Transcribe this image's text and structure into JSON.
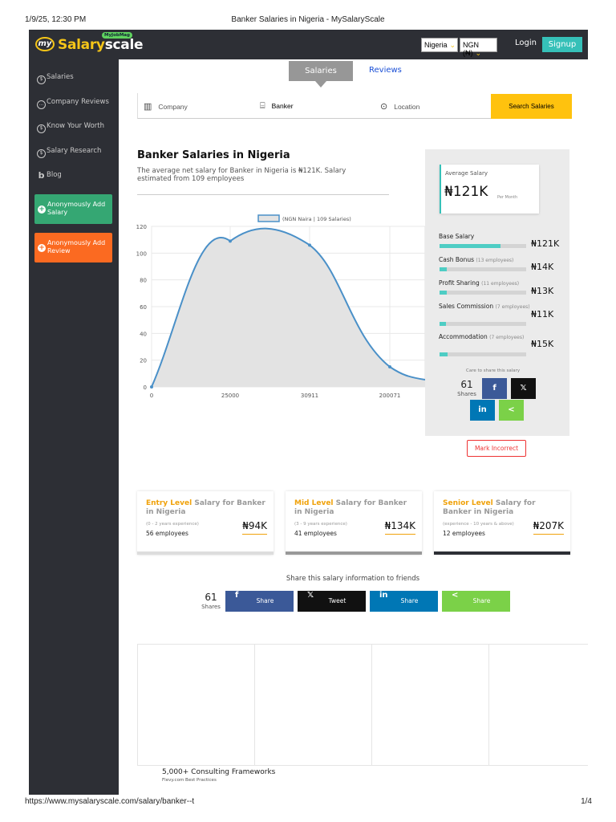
{
  "print": {
    "datetime": "1/9/25, 12:30 PM",
    "title": "Banker Salaries in Nigeria - MySalaryScale",
    "url": "https://www.mysalaryscale.com/salary/banker--t",
    "page": "1/4"
  },
  "header": {
    "logo_my": "my",
    "logo_salary": "Salary",
    "logo_scale": "scale",
    "logo_badge": "MyJobMag",
    "country": "Nigeria",
    "currency": "NGN (₦)",
    "login": "Login",
    "signup": "Signup"
  },
  "sidebar": {
    "items": [
      {
        "label": "Salaries",
        "icon": "salaries-icon",
        "glyph": "$"
      },
      {
        "label": "Company Reviews",
        "icon": "chat-icon",
        "glyph": "…"
      },
      {
        "label": "Know Your Worth",
        "icon": "money-icon",
        "glyph": "$"
      },
      {
        "label": "Salary Research",
        "icon": "search-icon",
        "glyph": "$"
      },
      {
        "label": "Blog",
        "icon": "blog-icon",
        "glyph": "b"
      }
    ],
    "add_salary": "Anonymously Add Salary",
    "add_review": "Anonymously Add Review"
  },
  "tabs": {
    "salaries": "Salaries",
    "reviews": "Reviews"
  },
  "search": {
    "company": "Company",
    "job": "Banker",
    "location": "Location",
    "button": "Search Salaries"
  },
  "main": {
    "heading": "Banker Salaries in Nigeria",
    "description": "The average net salary for Banker in Nigeria is ₦121K. Salary estimated from 109 employees"
  },
  "chart_data": {
    "type": "area",
    "legend": "(NGN Naira | 109 Salaries)",
    "x_ticks": [
      "0",
      "25000",
      "30911",
      "200071"
    ],
    "y_ticks": [
      "0",
      "20",
      "40",
      "60",
      "80",
      "100",
      "120"
    ],
    "ylim": [
      0,
      120
    ],
    "points": [
      {
        "x": "0",
        "y": 0
      },
      {
        "x": "25000",
        "y": 109
      },
      {
        "x": "30911",
        "y": 106
      },
      {
        "x": "200071",
        "y": 15
      }
    ],
    "color": "#4a90c8",
    "fill": "#e3e3e3"
  },
  "panel": {
    "avg_label": "Average Salary",
    "avg_value": "₦121K",
    "avg_per": "Per Month",
    "components": [
      {
        "label": "Base Salary",
        "note": "",
        "value": "₦121K",
        "fill": 0.7
      },
      {
        "label": "Cash Bonus",
        "note": "(13 employees)",
        "value": "₦14K",
        "fill": 0.08
      },
      {
        "label": "Profit Sharing",
        "note": "(11 employees)",
        "value": "₦13K",
        "fill": 0.08
      },
      {
        "label": "Sales Commission",
        "note": "(7 employees)",
        "value": "₦11K",
        "fill": 0.07
      },
      {
        "label": "Accommodation",
        "note": "(7 employees)",
        "value": "₦15K",
        "fill": 0.09
      }
    ],
    "care": "Care to share this salary",
    "shares_count": "61",
    "shares_label": "Shares"
  },
  "mark_incorrect": "Mark Incorrect",
  "levels": [
    {
      "accent": "Entry Level",
      "rest": " Salary for Banker in Nigeria",
      "range": "(0 - 2 years experience)",
      "employees": "56 employees",
      "value": "₦94K"
    },
    {
      "accent": "Mid Level",
      "rest": " Salary for Banker in Nigeria",
      "range": "(3 - 9 years experience)",
      "employees": "41 employees",
      "value": "₦134K"
    },
    {
      "accent": "Senior Level",
      "rest": " Salary for Banker in Nigeria",
      "range": "(experience - 10 years & above)",
      "employees": "12 employees",
      "value": "₦207K"
    }
  ],
  "share": {
    "title": "Share this salary information to friends",
    "count": "61",
    "count_label": "Shares",
    "facebook": "Share",
    "twitter": "Tweet",
    "linkedin": "Share",
    "generic": "Share"
  },
  "ad": {
    "title": "5,000+ Consulting Frameworks",
    "source": "Flevy.com Best Practices"
  },
  "colors": {
    "accent_teal": "#36c0b8",
    "accent_yellow": "#ffc20e",
    "dark": "#2d2f35",
    "orange": "#fb6a21",
    "green": "#35a773"
  }
}
